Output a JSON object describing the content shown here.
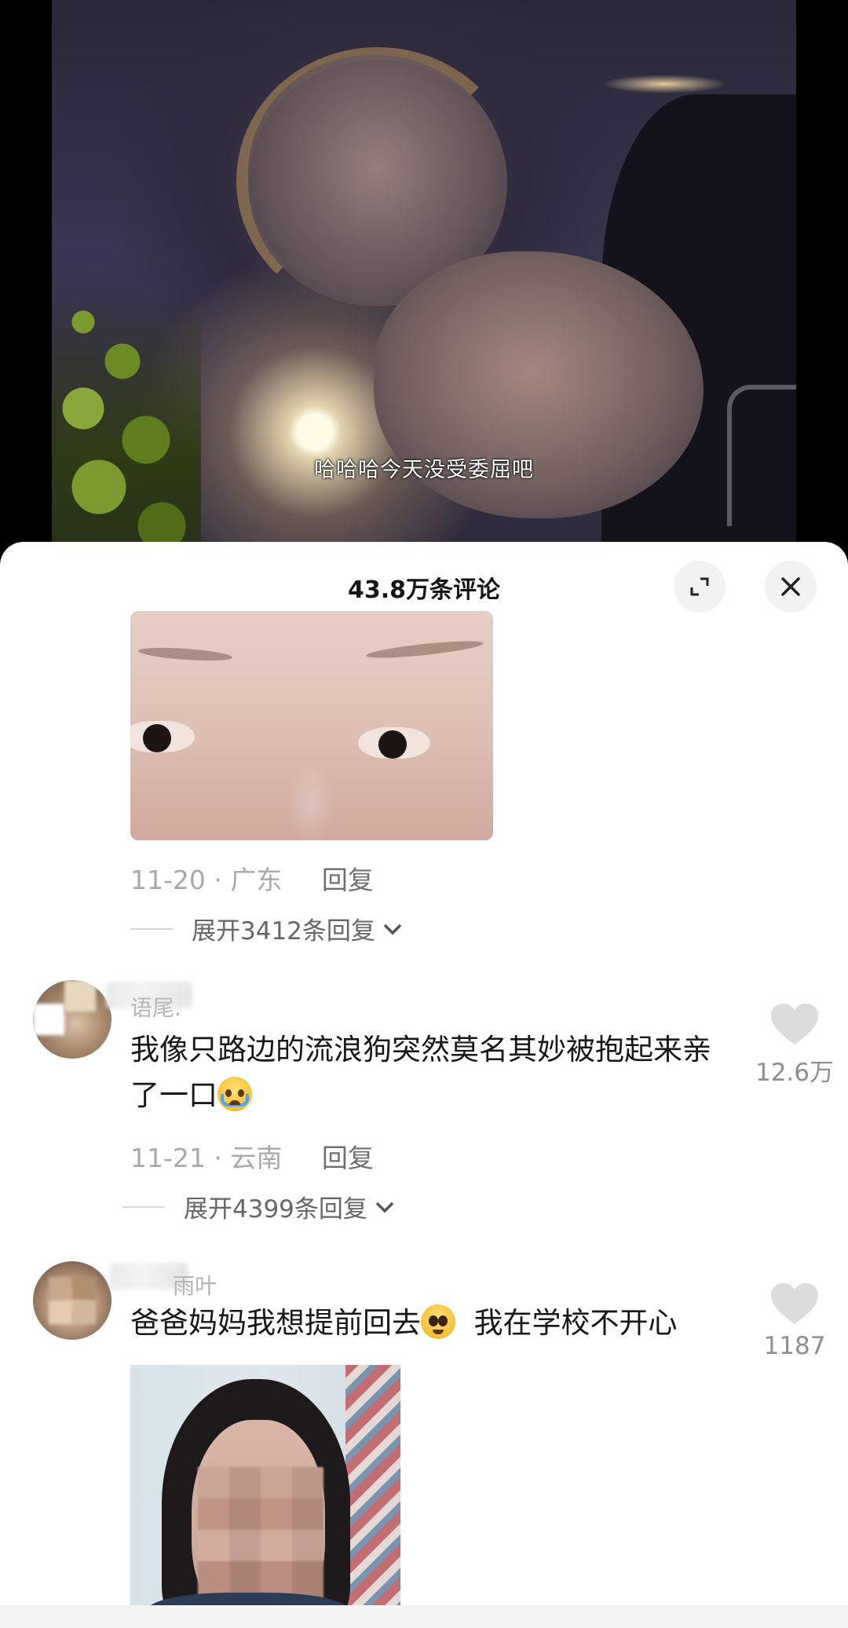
{
  "video": {
    "subtitle": "哈哈哈今天没受委屈吧"
  },
  "comments_panel": {
    "title": "43.8万条评论",
    "expand_icon": "expand-icon",
    "close_icon": "close-icon"
  },
  "comments": [
    {
      "has_image": true,
      "date": "11-20",
      "location": "· 广东",
      "reply_label": "回复",
      "expand_replies": "展开3412条回复"
    },
    {
      "username": "语尾.",
      "text": "我像只路边的流浪狗突然莫名其妙被抱起来亲了一口",
      "emoji": "loudly-crying-face-emoji",
      "likes": "12.6万",
      "date": "11-21",
      "location": "· 云南",
      "reply_label": "回复",
      "expand_replies": "展开4399条回复"
    },
    {
      "username": "雨叶",
      "text_before_emoji": "爸爸妈妈我想提前回去",
      "emoji": "pleading-face-emoji",
      "text_after_emoji": "我在学校不开心",
      "likes": "1187",
      "has_image": true
    }
  ],
  "colors": {
    "sheet_bg": "#ffffff",
    "meta_gray": "#a9a9a9",
    "text_dark": "#181818",
    "like_heart": "#d9d9d9"
  }
}
